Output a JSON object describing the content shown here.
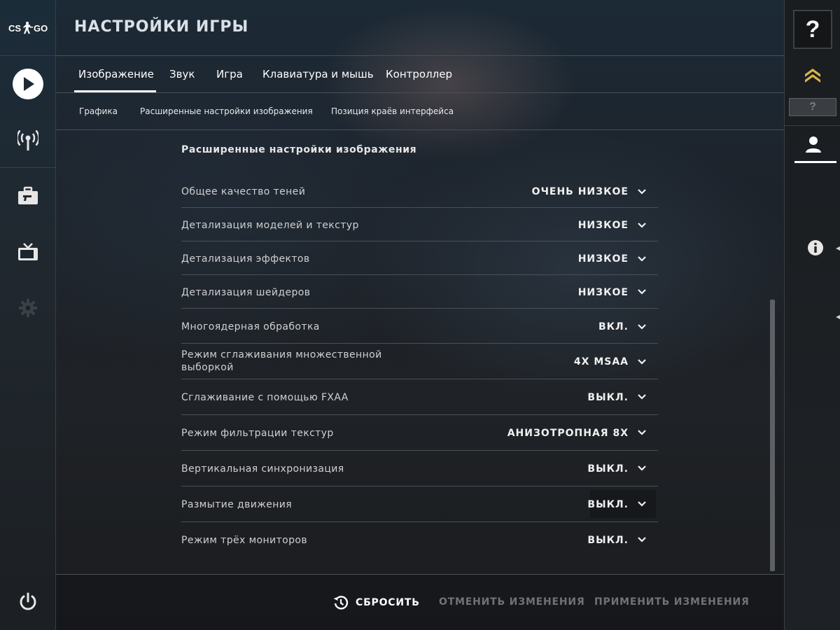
{
  "app": {
    "logo_text": "CS:GO",
    "title": "НАСТРОЙКИ ИГРЫ"
  },
  "left_nav": [
    {
      "icon": "play-icon"
    },
    {
      "icon": "broadcast-icon"
    },
    {
      "icon": "inventory-icon"
    },
    {
      "icon": "tv-icon"
    },
    {
      "icon": "gear-icon"
    },
    {
      "icon": "power-icon"
    }
  ],
  "tabs": [
    {
      "label": "Изображение",
      "active": true
    },
    {
      "label": "Звук"
    },
    {
      "label": "Игра"
    },
    {
      "label": "Клавиатура и мышь"
    },
    {
      "label": "Контроллер"
    }
  ],
  "subtabs": [
    {
      "label": "Графика"
    },
    {
      "label": "Расширенные настройки изображения"
    },
    {
      "label": "Позиция краёв интерфейса"
    }
  ],
  "section": {
    "title": "Расширенные настройки изображения",
    "settings": [
      {
        "label": "Общее качество теней",
        "value": "ОЧЕНЬ НИЗКОЕ"
      },
      {
        "label": "Детализация моделей и текстур",
        "value": "НИЗКОЕ"
      },
      {
        "label": "Детализация эффектов",
        "value": "НИЗКОЕ"
      },
      {
        "label": "Детализация шейдеров",
        "value": "НИЗКОЕ"
      },
      {
        "label": "Многоядерная обработка",
        "value": "ВКЛ."
      },
      {
        "label": "Режим сглаживания множественной выборкой",
        "value": "4X MSAA"
      },
      {
        "label": "Сглаживание с помощью FXAA",
        "value": "ВЫКЛ."
      },
      {
        "label": "Режим фильтрации текстур",
        "value": "АНИЗОТРОПНАЯ 8X"
      },
      {
        "label": "Вертикальная синхронизация",
        "value": "ВЫКЛ."
      },
      {
        "label": "Размытие движения",
        "value": "ВЫКЛ."
      },
      {
        "label": "Режим трёх мониторов",
        "value": "ВЫКЛ."
      }
    ]
  },
  "footer": {
    "reset_label": "СБРОСИТЬ",
    "cancel_label": "ОТМЕНИТЬ ИЗМЕНЕНИЯ",
    "apply_label": "ПРИМЕНИТЬ ИЗМЕНЕНИЯ"
  },
  "right_panel": {
    "help_label": "?",
    "rank_label": "?",
    "icons": [
      "rank-chevron-icon",
      "profile-icon",
      "info-icon"
    ]
  },
  "colors": {
    "accent": "#ffffff",
    "disabled_text": "#6f7377",
    "rank_gold": "#d8b54a"
  }
}
